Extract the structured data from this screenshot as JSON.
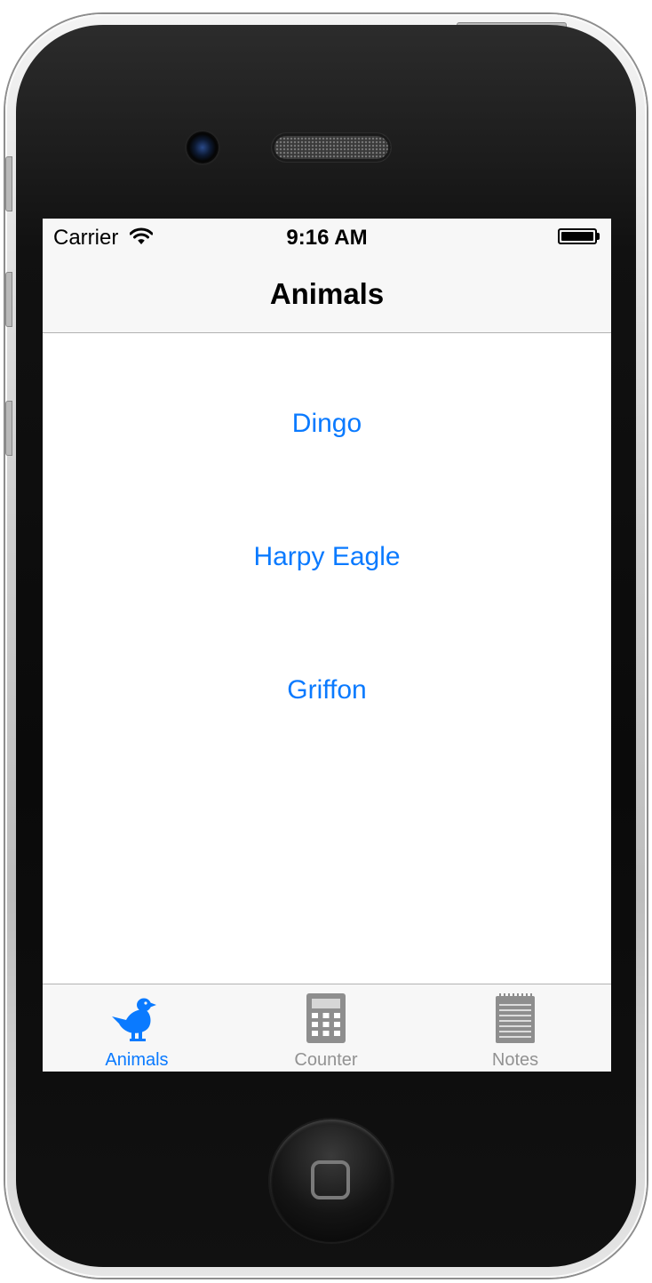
{
  "status_bar": {
    "carrier": "Carrier",
    "time": "9:16 AM",
    "wifi_icon": "wifi-icon",
    "battery_icon": "battery-icon"
  },
  "nav": {
    "title": "Animals"
  },
  "animals": {
    "buttons": [
      {
        "label": "Dingo"
      },
      {
        "label": "Harpy Eagle"
      },
      {
        "label": "Griffon"
      }
    ]
  },
  "tab_bar": {
    "tabs": [
      {
        "label": "Animals",
        "icon": "bird-icon",
        "selected": true
      },
      {
        "label": "Counter",
        "icon": "calculator-icon",
        "selected": false
      },
      {
        "label": "Notes",
        "icon": "notepad-icon",
        "selected": false
      }
    ]
  },
  "colors": {
    "tint": "#0a7aff",
    "inactive": "#929292",
    "bar_background": "#f7f7f7"
  }
}
